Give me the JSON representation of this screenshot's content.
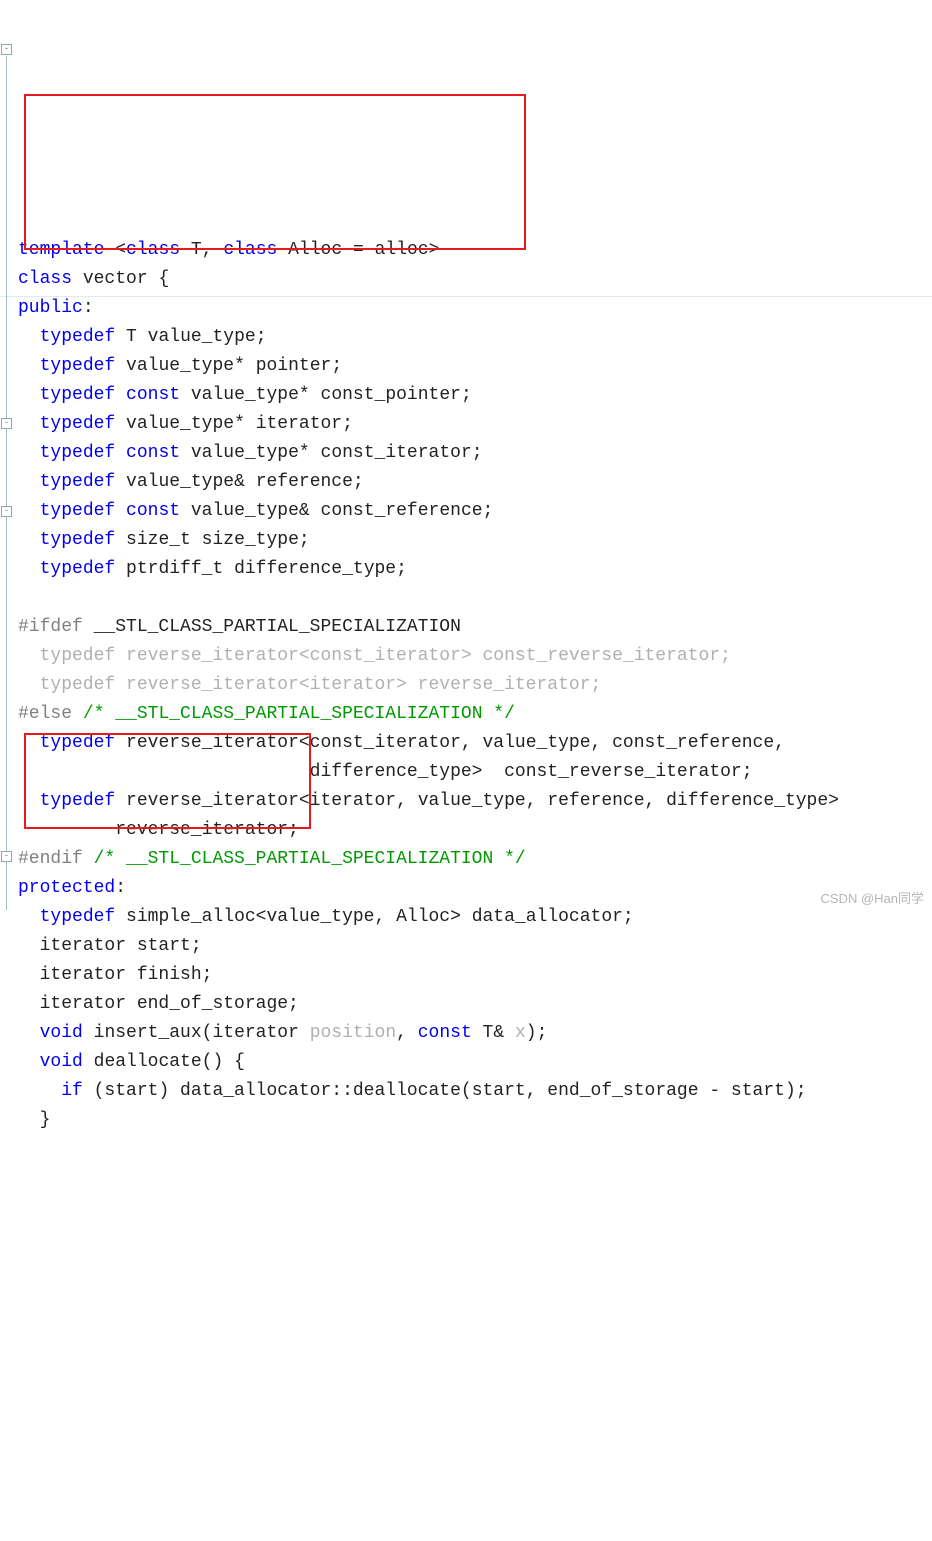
{
  "code": {
    "l1": {
      "kw1": "template",
      "op1": "<",
      "kw2": "class",
      "t": "T",
      "op2": ",",
      "kw3": "class",
      "a": "Alloc",
      "eq": "=",
      "al": "alloc",
      "op3": ">"
    },
    "l2": {
      "kw": "class",
      "name": "vector",
      "br": "{"
    },
    "l3": {
      "kw": "public",
      "col": ":"
    },
    "l4": {
      "kw": "typedef",
      "t": "T",
      "id": "value_type",
      "sc": ";"
    },
    "l5": {
      "kw": "typedef",
      "id1": "value_type*",
      "id2": "pointer",
      "sc": ";"
    },
    "l6": {
      "kw": "typedef",
      "cst": "const",
      "id1": "value_type*",
      "id2": "const_pointer",
      "sc": ";"
    },
    "l7": {
      "kw": "typedef",
      "id1": "value_type*",
      "id2": "iterator",
      "sc": ";"
    },
    "l8": {
      "kw": "typedef",
      "cst": "const",
      "id1": "value_type*",
      "id2": "const_iterator",
      "sc": ";"
    },
    "l9": {
      "kw": "typedef",
      "id1": "value_type&",
      "id2": "reference",
      "sc": ";"
    },
    "l10": {
      "kw": "typedef",
      "cst": "const",
      "id1": "value_type&",
      "id2": "const_reference",
      "sc": ";"
    },
    "l11": {
      "kw": "typedef",
      "id1": "size_t",
      "id2": "size_type",
      "sc": ";"
    },
    "l12": {
      "kw": "typedef",
      "id1": "ptrdiff_t",
      "id2": "difference_type",
      "sc": ";"
    },
    "l14": {
      "pre": "#ifdef",
      "macro": "__STL_CLASS_PARTIAL_SPECIALIZATION"
    },
    "l15": {
      "all": "  typedef reverse_iterator<const_iterator> const_reverse_iterator;"
    },
    "l16": {
      "all": "  typedef reverse_iterator<iterator> reverse_iterator;"
    },
    "l17": {
      "pre": "#else",
      "cm": "/* __STL_CLASS_PARTIAL_SPECIALIZATION */"
    },
    "l18": {
      "kw": "typedef",
      "txt": "reverse_iterator<const_iterator, value_type, const_reference, "
    },
    "l19": {
      "txt": "difference_type>  const_reverse_iterator;"
    },
    "l20": {
      "kw": "typedef",
      "txt": "reverse_iterator<iterator, value_type, reference, difference_type>"
    },
    "l21": {
      "txt": "reverse_iterator;"
    },
    "l22": {
      "pre": "#endif",
      "cm": "/* __STL_CLASS_PARTIAL_SPECIALIZATION */"
    },
    "l23": {
      "kw": "protected",
      "col": ":"
    },
    "l24": {
      "kw": "typedef",
      "txt": "simple_alloc<value_type, Alloc> data_allocator;"
    },
    "l25": {
      "txt": "iterator start;"
    },
    "l26": {
      "txt": "iterator finish;"
    },
    "l27": {
      "txt": "iterator end_of_storage;"
    },
    "l28": {
      "kw": "void",
      "fn": "insert_aux",
      "p1": "(iterator ",
      "param": "position",
      "p2": ", ",
      "cst": "const",
      "t": " T& ",
      "x": "x",
      "p3": ");"
    },
    "l29": {
      "kw": "void",
      "fn": "deallocate",
      "p": "() {"
    },
    "l30": {
      "kw": "if",
      "p1": " (start) data_allocator::deallocate(start, end_of_storage - start);"
    },
    "l31": {
      "br": "}"
    }
  },
  "watermark": "CSDN @Han同学"
}
